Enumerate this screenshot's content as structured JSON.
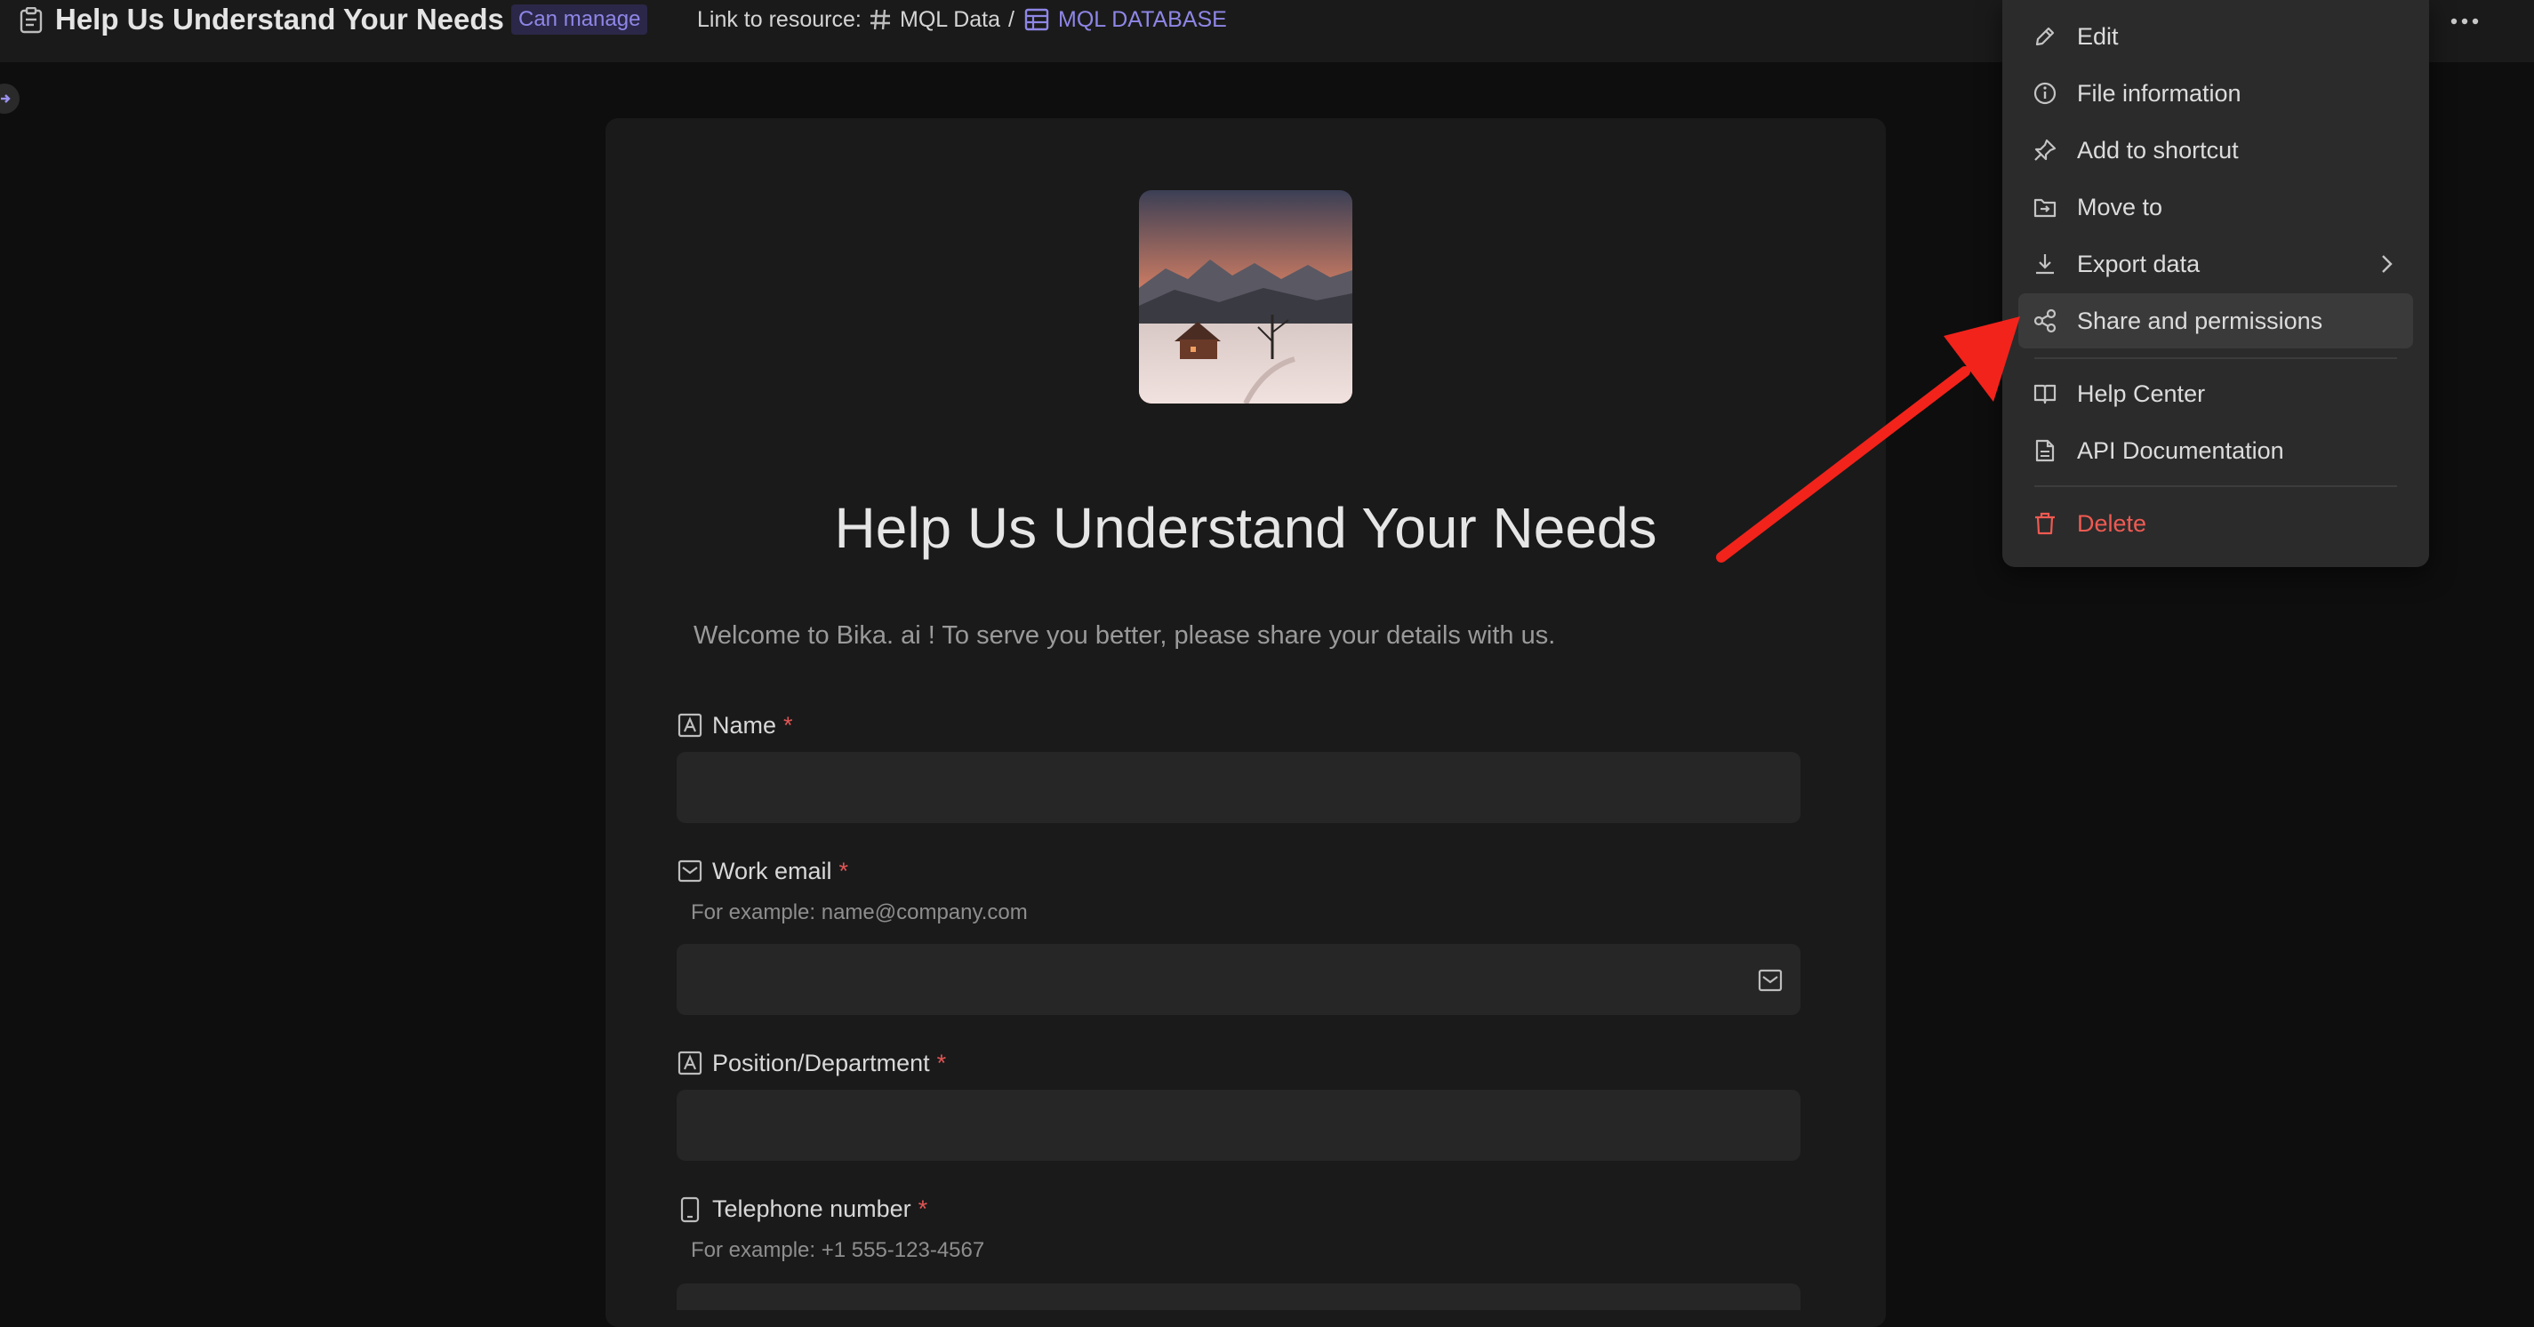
{
  "header": {
    "title": "Help Us Understand Your Needs",
    "permission_badge": "Can manage",
    "link_label": "Link to resource:",
    "breadcrumb": [
      {
        "label": "MQL Data",
        "icon": "hash-icon"
      },
      {
        "label": "/"
      },
      {
        "label": "MQL DATABASE",
        "icon": "table-icon"
      }
    ],
    "more_icon": "more-horizontal-icon"
  },
  "form": {
    "title": "Help Us Understand Your Needs",
    "description": "Welcome to Bika. ai !  To serve you better, please share your details with us.",
    "required_mark": "*",
    "fields": [
      {
        "label": "Name",
        "icon": "text-field-icon",
        "hint": "",
        "value": ""
      },
      {
        "label": "Work email",
        "icon": "email-icon",
        "hint": "For example: name@company.com",
        "value": ""
      },
      {
        "label": "Position/Department",
        "icon": "text-field-icon",
        "hint": "",
        "value": ""
      },
      {
        "label": "Telephone number",
        "icon": "phone-icon",
        "hint": "For example: +1 555-123-4567",
        "value": ""
      }
    ]
  },
  "menu": {
    "items": [
      {
        "label": "Edit",
        "icon": "pencil-icon"
      },
      {
        "label": "File information",
        "icon": "info-icon"
      },
      {
        "label": "Add to shortcut",
        "icon": "pin-icon"
      },
      {
        "label": "Move to",
        "icon": "move-icon"
      },
      {
        "label": "Export data",
        "icon": "download-icon",
        "submenu": true
      },
      {
        "label": "Share and permissions",
        "icon": "share-icon",
        "active": true
      },
      {
        "label": "Help Center",
        "icon": "book-icon"
      },
      {
        "label": "API Documentation",
        "icon": "document-icon"
      },
      {
        "label": "Delete",
        "icon": "trash-icon",
        "danger": true
      }
    ]
  },
  "colors": {
    "accent": "#8e86e6",
    "danger": "#ef5a52",
    "annotation_arrow": "#f2231b"
  }
}
